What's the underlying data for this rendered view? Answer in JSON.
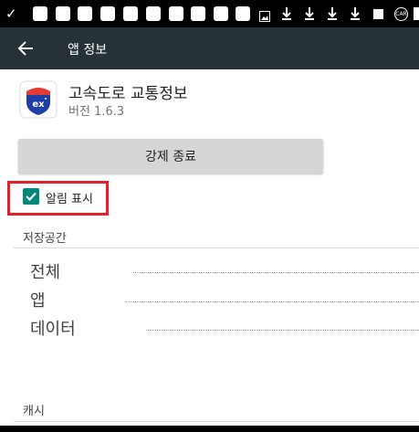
{
  "status_bar": {
    "glyph": "✓ˈ",
    "data_icon": "CAR"
  },
  "app_bar": {
    "title": "앱 정보"
  },
  "app": {
    "name": "고속도로 교통정보",
    "version": "버전 1.6.3",
    "icon_label": "ex",
    "icon_colors": {
      "badge": "#1e3fa6",
      "top": "#e53935"
    }
  },
  "actions": {
    "force_stop": "강제 종료"
  },
  "notifications": {
    "label": "알림 표시",
    "checked": true,
    "checkbox_color": "#00897b"
  },
  "storage": {
    "header": "저장공간",
    "rows": [
      {
        "label": "전체"
      },
      {
        "label": "앱"
      },
      {
        "label": "데이터"
      }
    ]
  },
  "cache": {
    "header": "캐시"
  },
  "colors": {
    "app_bar": "#263238",
    "highlight": "#e5202b",
    "button": "#d6d6d6"
  }
}
